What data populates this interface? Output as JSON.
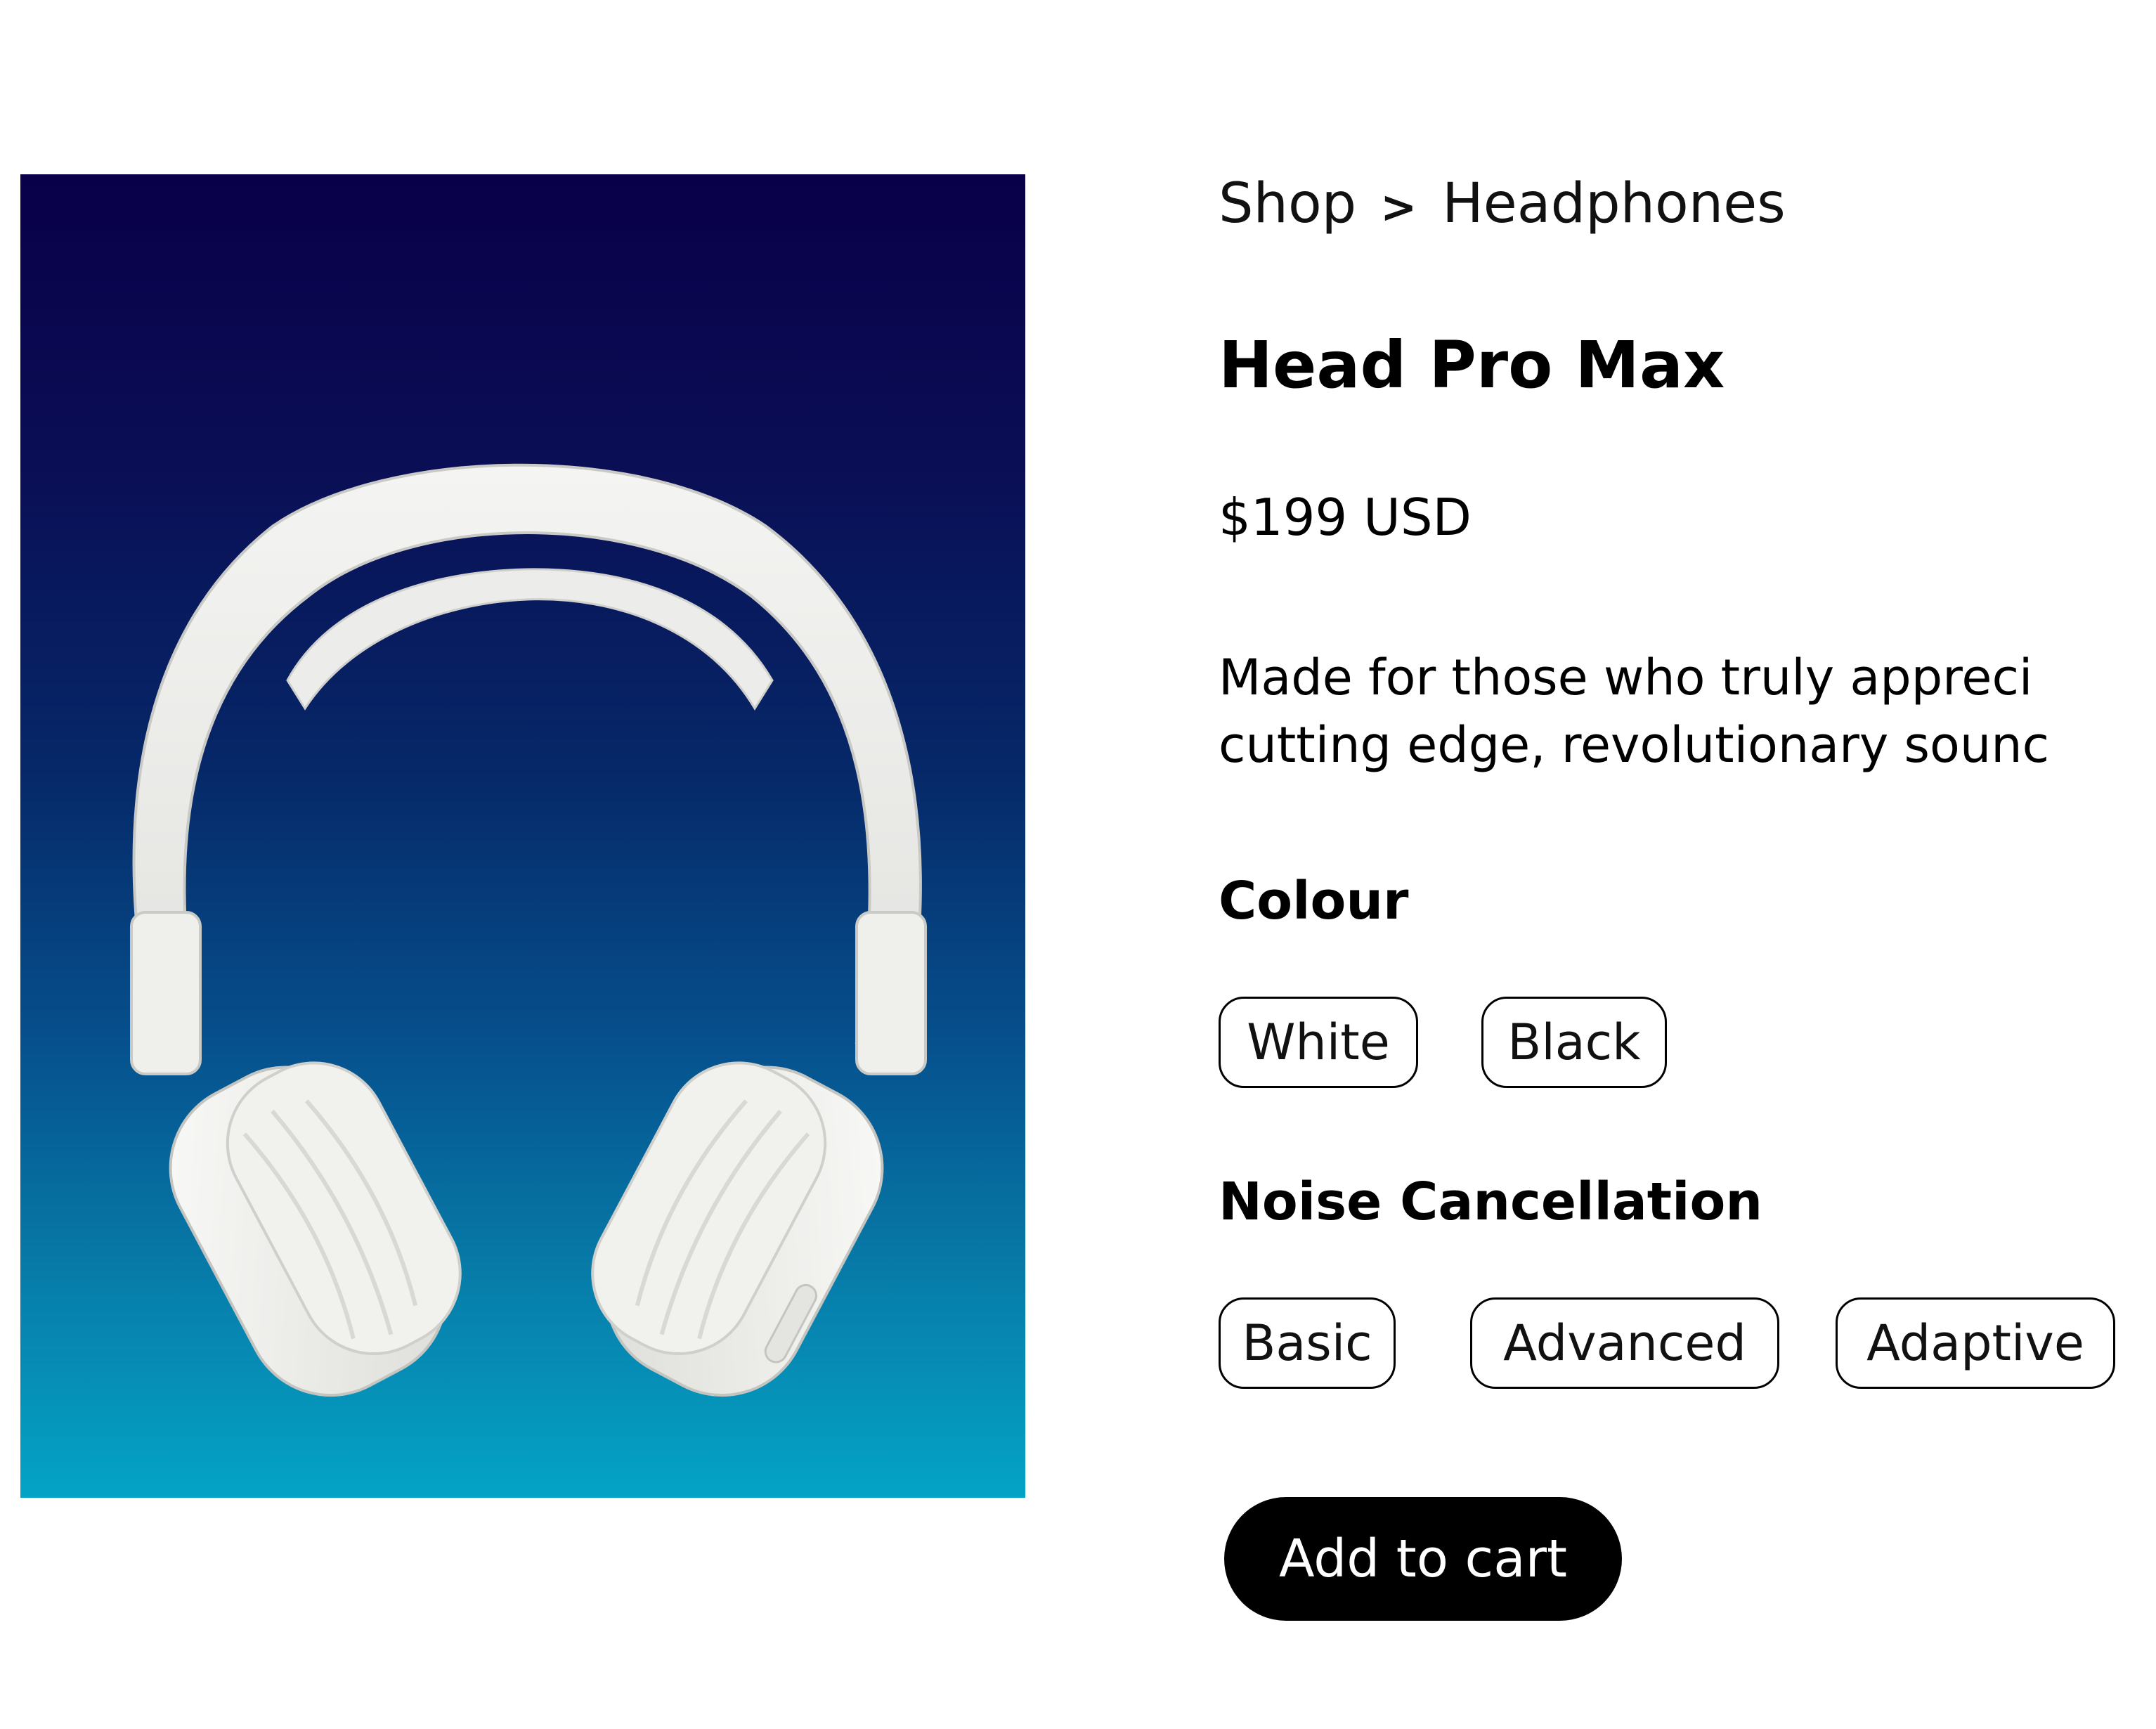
{
  "product": {
    "image_alt": "White wireless over-ear headphones",
    "image_gradient": {
      "top": "#090049",
      "bottom": "#04a4c6"
    }
  },
  "breadcrumb": {
    "items": [
      "Shop",
      "Headphones"
    ],
    "separator": ">"
  },
  "title": "Head Pro Max",
  "price": "$199 USD",
  "description": {
    "line1": "Made for those who truly appreci",
    "line2": "cutting edge, revolutionary sounc"
  },
  "colour": {
    "heading": "Colour",
    "options": [
      "White",
      "Black"
    ]
  },
  "noise_cancellation": {
    "heading": "Noise Cancellation",
    "options": [
      "Basic",
      "Advanced",
      "Adaptive"
    ]
  },
  "cart": {
    "label": "Add to cart",
    "button_color": "#000000"
  }
}
